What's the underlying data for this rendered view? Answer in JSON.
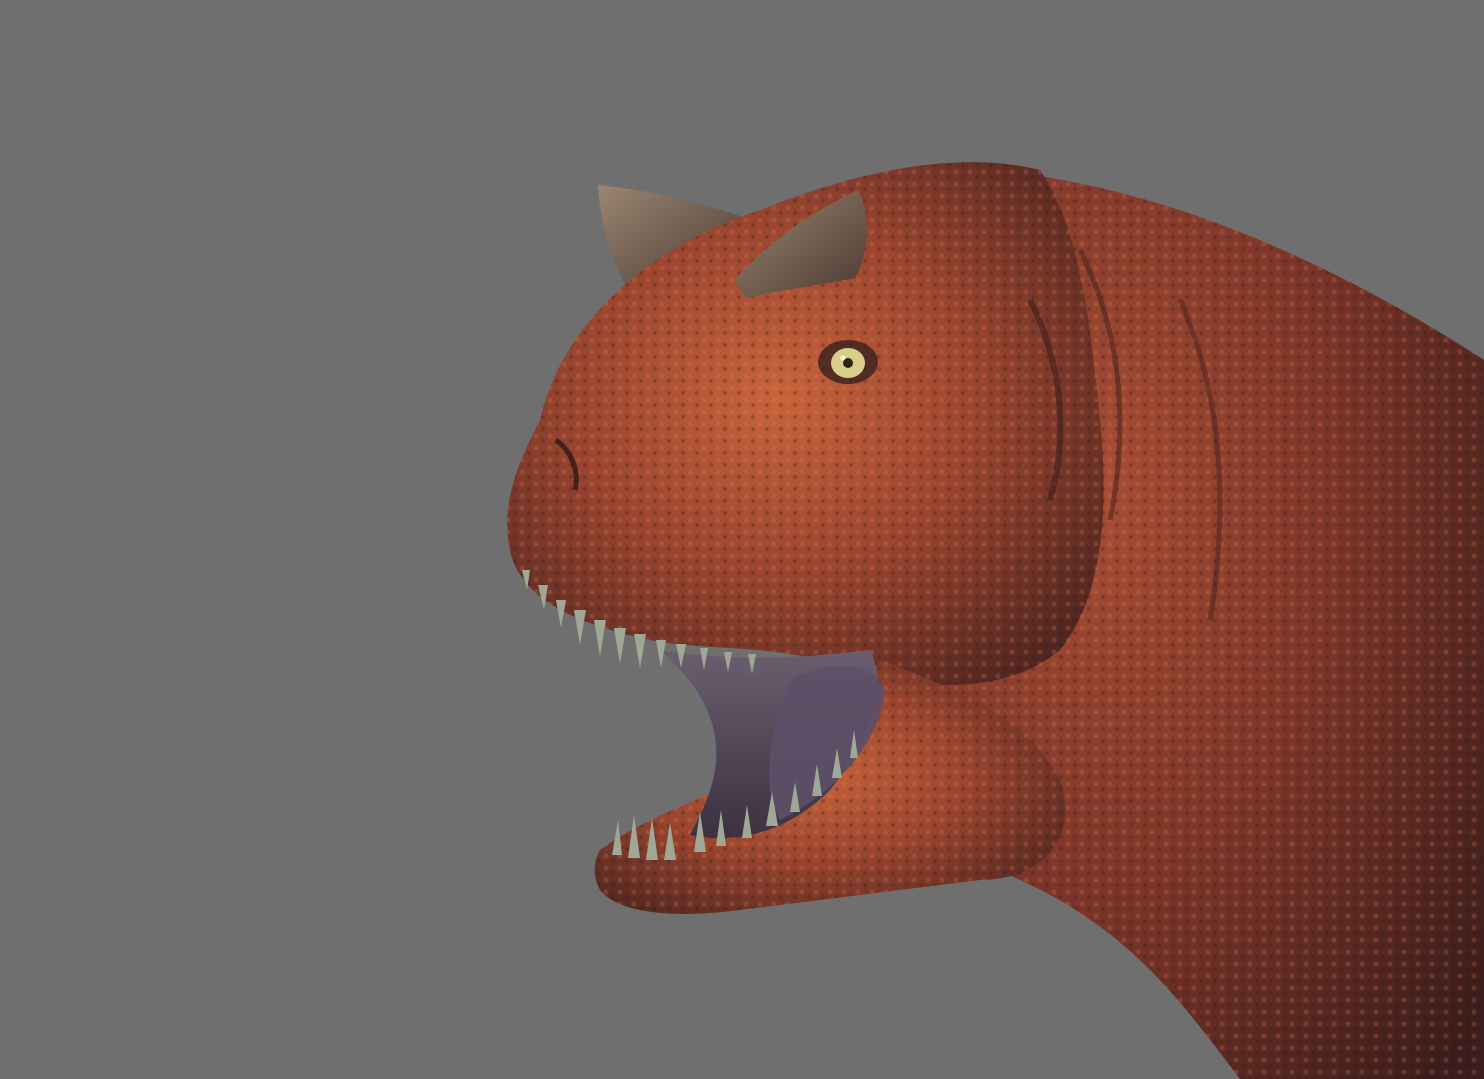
{
  "scene": {
    "subject": "carnotaurus-head-render",
    "colors": {
      "background": "#6f6f6f",
      "skin_base": "#8a3a2a",
      "skin_highlight": "#c8643c",
      "skin_shadow": "#3e1f1d",
      "horn": "#6f5a48",
      "eye": "#d7cf8a",
      "teeth": "#9fa894",
      "mouth_interior": "#4f4656"
    }
  }
}
